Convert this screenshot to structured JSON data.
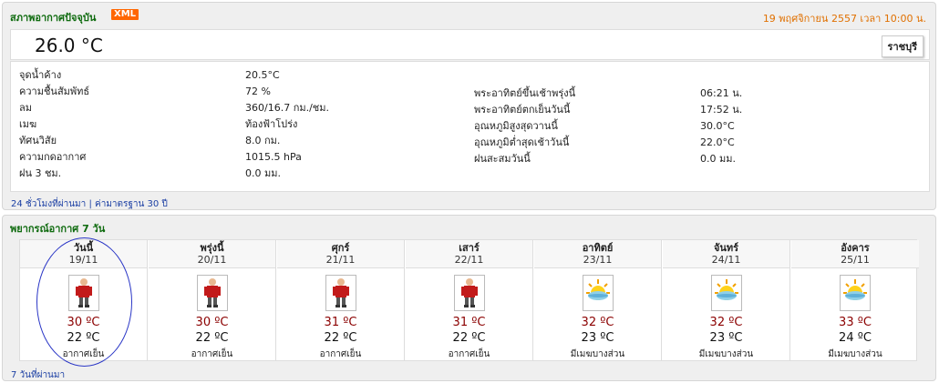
{
  "current": {
    "title": "สภาพอากาศปัจจุบัน",
    "xml_label": "XML",
    "datetime": "19 พฤศจิกายน 2557 เวลา 10:00 น.",
    "temperature": "26.0 °C",
    "province": "ราชบุรี",
    "left": [
      {
        "label": "จุดน้ำค้าง",
        "value": "20.5°C"
      },
      {
        "label": "ความชื้นสัมพัทธ์",
        "value": "72 %"
      },
      {
        "label": "ลม",
        "value": "360/16.7 กม./ชม."
      },
      {
        "label": "เมฆ",
        "value": "ท้องฟ้าโปร่ง"
      },
      {
        "label": "ทัศนวิสัย",
        "value": "8.0 กม."
      },
      {
        "label": "ความกดอากาศ",
        "value": "1015.5 hPa"
      },
      {
        "label": "ฝน 3 ชม.",
        "value": "0.0 มม."
      }
    ],
    "right": [
      {
        "label": "พระอาทิตย์ขึ้นเช้าพรุ่งนี้",
        "value": "06:21 น."
      },
      {
        "label": "พระอาทิตย์ตกเย็นวันนี้",
        "value": "17:52 น."
      },
      {
        "label": "อุณหภูมิสูงสุดวานนี้",
        "value": "30.0°C"
      },
      {
        "label": "อุณหภูมิต่ำสุดเช้าวันนี้",
        "value": "22.0°C"
      },
      {
        "label": "ฝนสะสมวันนี้",
        "value": "0.0 มม."
      }
    ],
    "link_24h": "24 ชั่วโมงที่ผ่านมา",
    "link_sep": "|",
    "link_30y": "ค่ามาตรฐาน 30 ปี"
  },
  "forecast": {
    "title": "พยากรณ์อากาศ 7 วัน",
    "past_link": "7 วันที่ผ่านมา",
    "days": [
      {
        "name": "วันนี้",
        "date": "19/11",
        "max": "30 ºC",
        "min": "22 ºC",
        "desc": "อากาศเย็น",
        "icon": "cold-person-icon"
      },
      {
        "name": "พรุ่งนี้",
        "date": "20/11",
        "max": "30 ºC",
        "min": "22 ºC",
        "desc": "อากาศเย็น",
        "icon": "cold-person-icon"
      },
      {
        "name": "ศุกร์",
        "date": "21/11",
        "max": "31 ºC",
        "min": "22 ºC",
        "desc": "อากาศเย็น",
        "icon": "cold-person-icon"
      },
      {
        "name": "เสาร์",
        "date": "22/11",
        "max": "31 ºC",
        "min": "22 ºC",
        "desc": "อากาศเย็น",
        "icon": "cold-person-icon"
      },
      {
        "name": "อาทิตย์",
        "date": "23/11",
        "max": "32 ºC",
        "min": "23 ºC",
        "desc": "มีเมฆบางส่วน",
        "icon": "partly-cloudy-icon"
      },
      {
        "name": "จันทร์",
        "date": "24/11",
        "max": "32 ºC",
        "min": "23 ºC",
        "desc": "มีเมฆบางส่วน",
        "icon": "partly-cloudy-icon"
      },
      {
        "name": "อังคาร",
        "date": "25/11",
        "max": "33 ºC",
        "min": "24 ºC",
        "desc": "มีเมฆบางส่วน",
        "icon": "partly-cloudy-icon"
      }
    ]
  }
}
